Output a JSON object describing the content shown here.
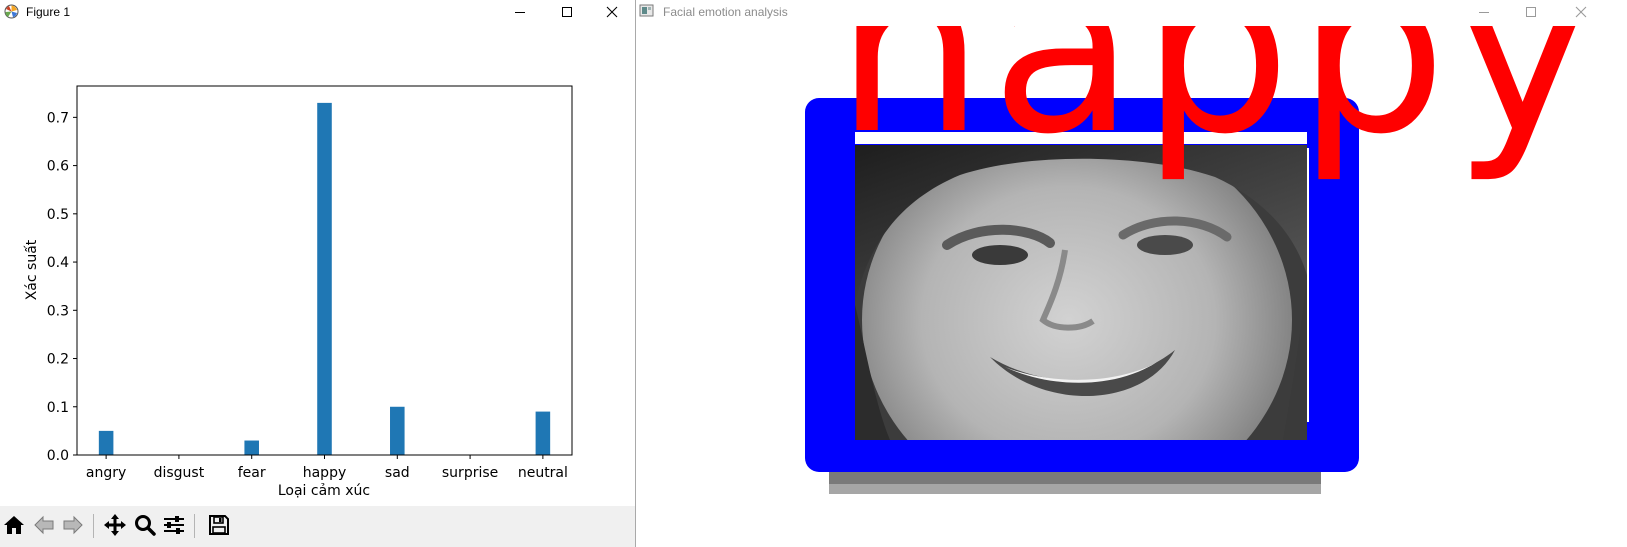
{
  "figure_window": {
    "title": "Figure 1",
    "icon": "matplotlib-icon",
    "controls": [
      "minimize-icon",
      "maximize-icon",
      "close-icon"
    ]
  },
  "chart_data": {
    "type": "bar",
    "categories": [
      "angry",
      "disgust",
      "fear",
      "happy",
      "sad",
      "surprise",
      "neutral"
    ],
    "values": [
      0.05,
      0.0,
      0.03,
      0.73,
      0.1,
      0.0,
      0.09
    ],
    "title": "",
    "xlabel": "Loại cảm xúc",
    "ylabel": "Xác suất",
    "ylim": [
      0,
      0.765
    ],
    "yticks": [
      "0.0",
      "0.1",
      "0.2",
      "0.3",
      "0.4",
      "0.5",
      "0.6",
      "0.7"
    ],
    "bar_color": "#1f77b4",
    "grid": false,
    "legend": "none"
  },
  "toolbar": {
    "tools": [
      "home-icon",
      "back-arrow-icon",
      "forward-arrow-icon",
      "pan-icon",
      "zoom-icon",
      "configure-subplots-icon",
      "save-icon"
    ]
  },
  "cv_window": {
    "title": "Facial emotion analysis",
    "icon": "opencv-window-icon",
    "controls": [
      "minimize-icon",
      "maximize-icon",
      "close-icon"
    ],
    "emotion_label": "happy",
    "label_color": "#ff0000",
    "box_color": "#0000ff"
  }
}
